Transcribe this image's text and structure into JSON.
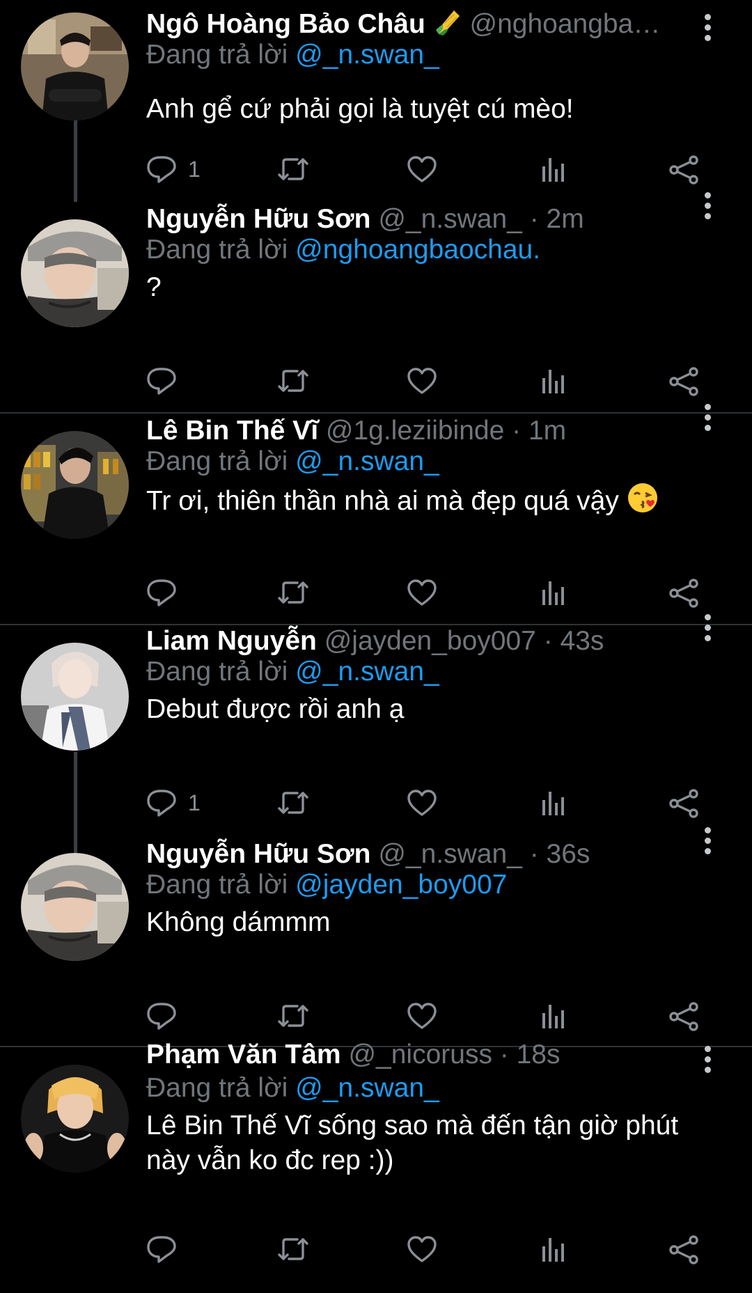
{
  "reply_prefix": "Đang trả lời",
  "tweets": [
    {
      "name": "Ngô Hoàng Bảo Châu",
      "name_emoji": "corn",
      "handle": "@nghoangba…",
      "time": "",
      "replying_to": "@_n.swan_",
      "text": "Anh gể cứ phải gọi là tuyệt cú mèo!",
      "reply_count": "1",
      "text_emoji": ""
    },
    {
      "name": "Nguyễn Hữu Sơn",
      "name_emoji": "",
      "handle": "@_n.swan_",
      "time": "· 2m",
      "replying_to": "@nghoangbaochau.",
      "text": "?",
      "reply_count": "",
      "text_emoji": ""
    },
    {
      "name": "Lê Bin Thế Vĩ",
      "name_emoji": "",
      "handle": "@1g.leziibinde",
      "time": "· 1m",
      "replying_to": "@_n.swan_",
      "text": "Tr ơi, thiên thần nhà ai mà đẹp quá vậy",
      "reply_count": "",
      "text_emoji": "kissing-face"
    },
    {
      "name": "Liam Nguyễn",
      "name_emoji": "",
      "handle": "@jayden_boy007",
      "time": "· 43s",
      "replying_to": "@_n.swan_",
      "text": "Debut được rồi anh ạ",
      "reply_count": "1",
      "text_emoji": ""
    },
    {
      "name": "Nguyễn Hữu Sơn",
      "name_emoji": "",
      "handle": "@_n.swan_",
      "time": "· 36s",
      "replying_to": "@jayden_boy007",
      "text": "Không dámmm",
      "reply_count": "",
      "text_emoji": ""
    },
    {
      "name": "Phạm Văn Tâm",
      "name_emoji": "",
      "handle": "@_nicoruss",
      "time": "· 18s",
      "replying_to": "@_n.swan_",
      "text": "Lê Bin Thế Vĩ sống sao mà đến tận giờ phút này vẫn ko đc rep :))",
      "reply_count": "",
      "text_emoji": ""
    }
  ],
  "icons": [
    "reply-icon",
    "retweet-icon",
    "like-icon",
    "views-icon",
    "share-icon",
    "more-icon"
  ],
  "colors": {
    "background": "#000000",
    "text": "#ffffff",
    "muted": "#71767b",
    "link": "#1d9bf0",
    "divider": "#2f3336"
  }
}
